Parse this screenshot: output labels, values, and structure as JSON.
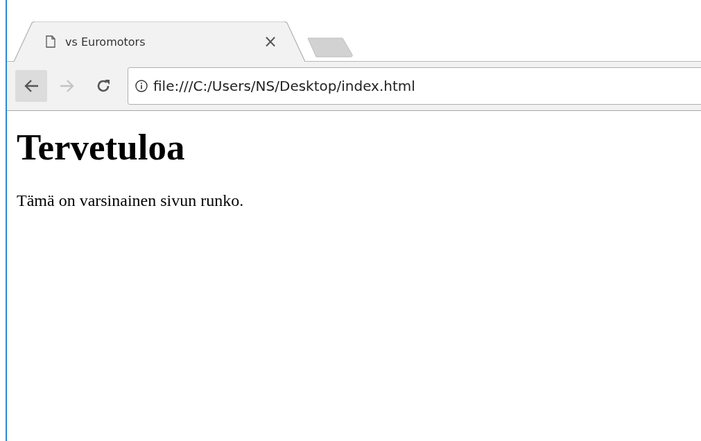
{
  "tabs": [
    {
      "title": "vs Euromotors",
      "close": "×",
      "selected": true
    }
  ],
  "toolbar": {
    "nav": [
      {
        "kind": "back",
        "disabled": false,
        "hovered": true
      },
      {
        "kind": "forward",
        "disabled": true,
        "hovered": false
      },
      {
        "kind": "reload",
        "disabled": false,
        "hovered": false
      }
    ],
    "address": {
      "value": "file:///C:/Users/NS/Desktop/index.html"
    }
  },
  "page": {
    "heading": "Tervetuloa",
    "paragraph": "Tämä on varsinainen sivun runko."
  }
}
